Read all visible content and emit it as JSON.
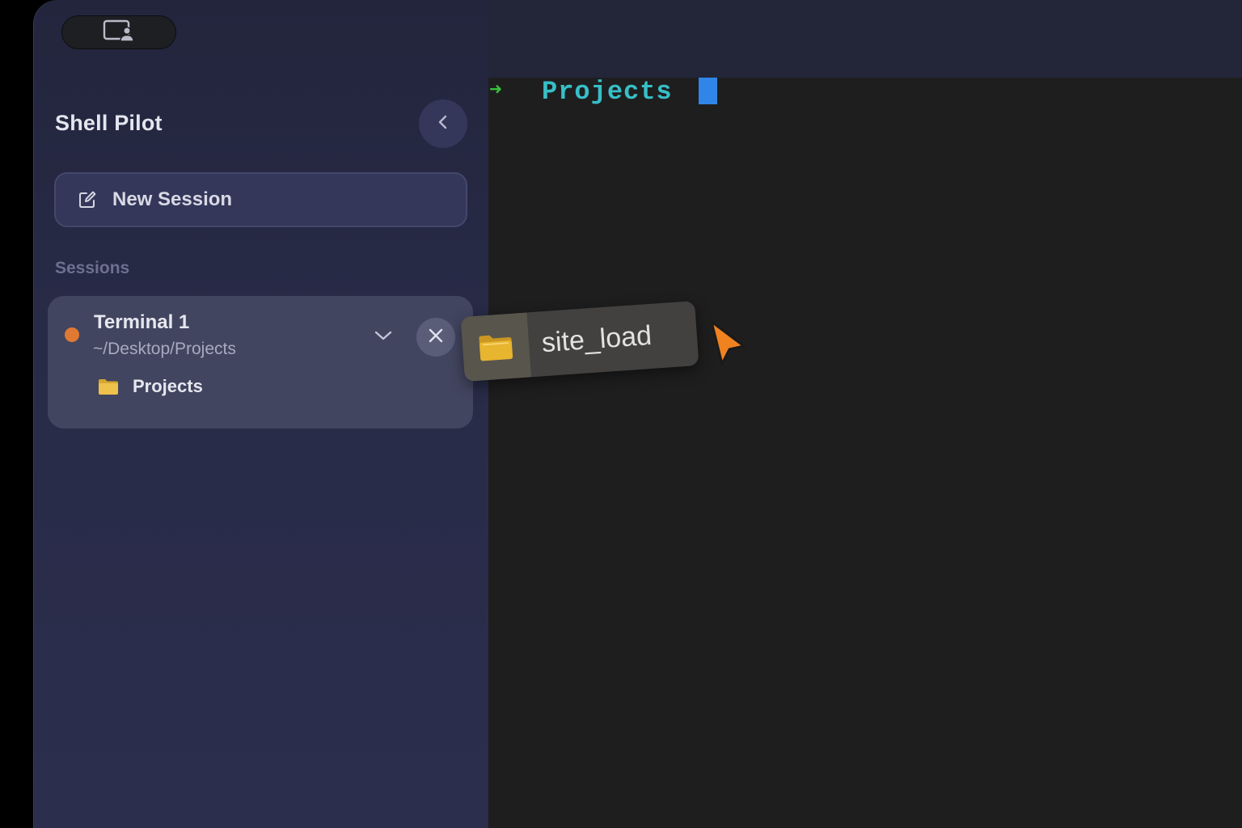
{
  "app": {
    "title": "Shell Pilot"
  },
  "sidebar": {
    "user_pill_icon": "window-person-icon",
    "collapse_icon": "chevron-left-icon",
    "new_session": {
      "label": "New Session",
      "icon": "compose-icon"
    },
    "sessions_heading": "Sessions",
    "sessions": [
      {
        "name": "Terminal 1",
        "path": "~/Desktop/Projects",
        "status_color": "#e07a33",
        "folder_label": "Projects",
        "expand_icon": "chevron-down-icon",
        "close_icon": "close-icon"
      }
    ]
  },
  "terminal": {
    "prompt_arrow": "➜",
    "directory": "Projects",
    "arrow_color": "#36c23a",
    "directory_color": "#37bfc7",
    "cursor_color": "#2f86e8"
  },
  "drag_item": {
    "label": "site_load",
    "icon": "folder-icon"
  },
  "pointer": {
    "icon": "cursor-arrow-icon",
    "color": "#f0821f"
  },
  "colors": {
    "folder": "#e6bb3f",
    "sidebar_bg": "#282b47",
    "terminal_bg": "#1e1e1f"
  }
}
